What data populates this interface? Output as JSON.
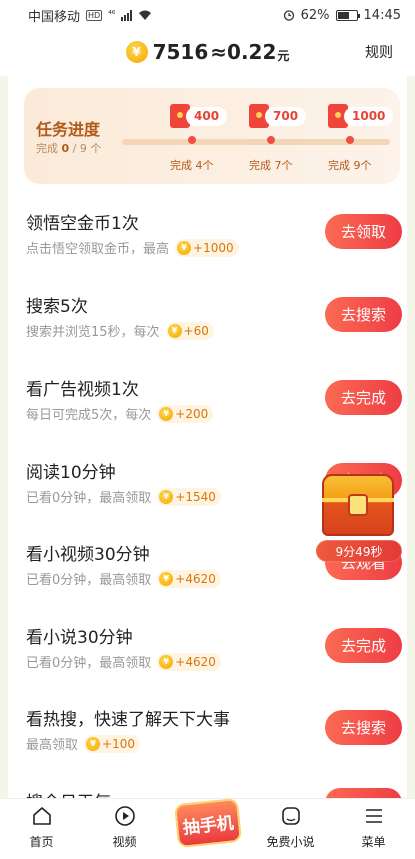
{
  "status_bar": {
    "carrier": "中国移动",
    "network_badge": "HD",
    "signal_label": "⁴⁶",
    "battery": "62%",
    "time": "14:45"
  },
  "header": {
    "coin_icon": "¥",
    "coins": "7516",
    "approx": "≈0.22",
    "unit": "元",
    "rules": "规则"
  },
  "progress": {
    "title": "任务进度",
    "done_prefix": "完成",
    "done": "0",
    "total": "/ 9 个",
    "milestones": [
      {
        "reward": "400",
        "label": "完成 4个"
      },
      {
        "reward": "700",
        "label": "完成 7个"
      },
      {
        "reward": "1000",
        "label": "完成 9个"
      }
    ]
  },
  "tasks": [
    {
      "title": "领悟空金币1次",
      "desc": "点击悟空领取金币，最高",
      "reward": "+1000",
      "button": "去领取"
    },
    {
      "title": "搜索5次",
      "desc": "搜索并浏览15秒，每次",
      "reward": "+60",
      "button": "去搜索"
    },
    {
      "title": "看广告视频1次",
      "desc": "每日可完成5次，每次",
      "reward": "+200",
      "button": "去完成"
    },
    {
      "title": "阅读10分钟",
      "desc": "已看0分钟，最高领取",
      "reward": "+1540",
      "button": "去阅读"
    },
    {
      "title": "看小视频30分钟",
      "desc": "已看0分钟，最高领取",
      "reward": "+4620",
      "button": "去观看"
    },
    {
      "title": "看小说30分钟",
      "desc": "已看0分钟，最高领取",
      "reward": "+4620",
      "button": "去完成"
    },
    {
      "title": "看热搜，快速了解天下大事",
      "desc": "最高领取",
      "reward": "+100",
      "button": "去搜索"
    },
    {
      "title": "搜今日天气",
      "desc": "",
      "reward": "",
      "button": ""
    }
  ],
  "chest": {
    "timer": "9分49秒"
  },
  "bottom_nav": {
    "home": "首页",
    "video": "视频",
    "lottery": "抽手机",
    "novel": "免费小说",
    "menu": "菜单"
  }
}
